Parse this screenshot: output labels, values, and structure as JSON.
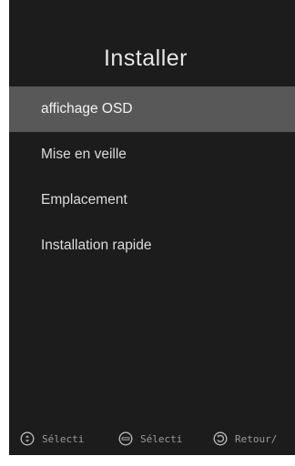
{
  "header": {
    "title": "Installer"
  },
  "menu": {
    "selected_index": 0,
    "items": [
      {
        "label": "affichage OSD"
      },
      {
        "label": "Mise en veille"
      },
      {
        "label": "Emplacement"
      },
      {
        "label": "Installation rapide"
      }
    ]
  },
  "footer": {
    "hints": [
      {
        "icon": "navigate-updown-icon",
        "label": "Sélecti"
      },
      {
        "icon": "enter-icon",
        "label": "Sélecti"
      },
      {
        "icon": "return-icon",
        "label": "Retour/"
      }
    ]
  },
  "colors": {
    "panel_background": "#1c1c1c",
    "selected_row": "#585858",
    "text": "#dcdcdc",
    "footer_text": "#9a9a9a"
  }
}
